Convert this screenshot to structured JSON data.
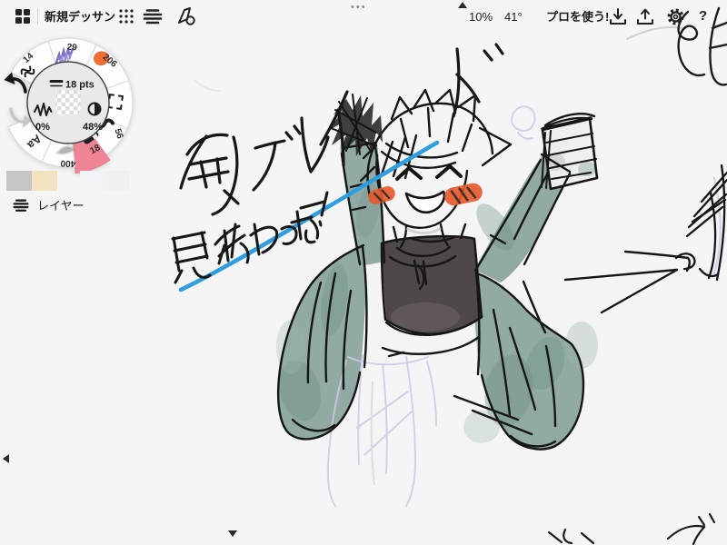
{
  "window": {
    "dots_handle": "•••"
  },
  "toolbar": {
    "title": "新規デッサン",
    "zoom": "10%",
    "angle": "41°",
    "pro_button": "プロを使う!",
    "help": "?"
  },
  "tool_wheel": {
    "stroke_size": "18 pts",
    "smoothing": "0%",
    "opacity": "48%",
    "selected_highlight": "#ee8494",
    "tools": [
      {
        "label": "14",
        "kind": "pencil"
      },
      {
        "label": "29",
        "kind": "watercolor-brush"
      },
      {
        "label": "206",
        "kind": "marker"
      },
      {
        "label": "",
        "kind": "selection"
      },
      {
        "label": "56",
        "kind": "ink-pen"
      },
      {
        "label": "18",
        "kind": "eraser",
        "selected": true
      },
      {
        "label": "400",
        "kind": "soft-pencil"
      },
      {
        "label": "Aa",
        "kind": "text"
      }
    ]
  },
  "swatches": [
    {
      "color": "#c6c6c8"
    },
    {
      "color": "#f2e2bf"
    },
    {
      "color": "#f1f4f6"
    },
    {
      "color": "#edf1f4"
    }
  ],
  "layers": {
    "label": "レイヤー"
  },
  "canvas": {
    "handwriting": [
      {
        "text": "剣ブレイド"
      },
      {
        "text": "見終わったー!"
      }
    ],
    "colors": {
      "jacket": "#8ba69e",
      "tank_top": "#4e474b",
      "blush": "#e65a2c",
      "underline_blue": "#2f9ede",
      "sketch_lavender": "#cfc9e5"
    }
  }
}
